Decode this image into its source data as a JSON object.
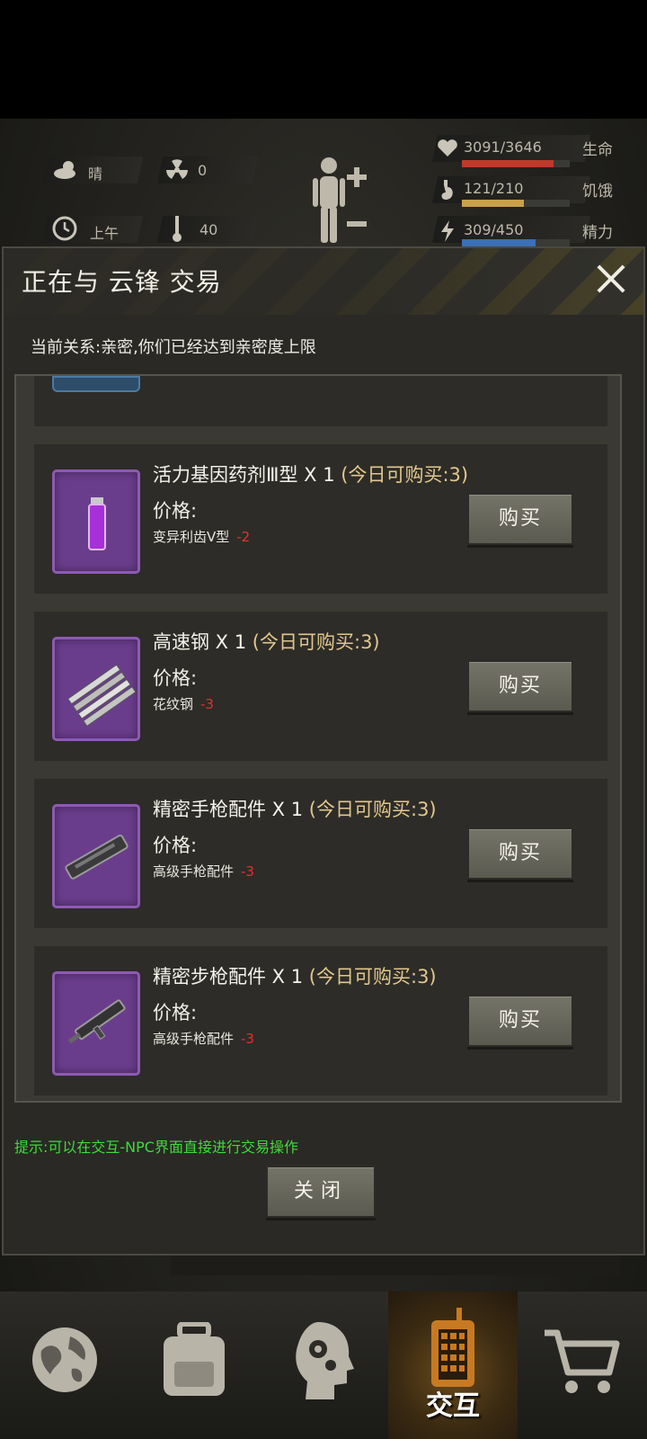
{
  "status": {
    "weather": "晴",
    "radiation": "0",
    "time_of_day": "上午",
    "temperature": "40",
    "health": {
      "value": "3091/3646",
      "label": "生命",
      "fraction": 0.848,
      "color": "#c0392b"
    },
    "hunger": {
      "value": "121/210",
      "label": "饥饿",
      "fraction": 0.576,
      "color": "#c8a14a"
    },
    "energy": {
      "value": "309/450",
      "label": "精力",
      "fraction": 0.687,
      "color": "#3c6fb5"
    }
  },
  "dialog": {
    "title": "正在与 云锋 交易",
    "relation": "当前关系:亲密,你们已经达到亲密度上限",
    "price_label": "价格:",
    "buy_label": "购买",
    "items": [
      {
        "name": "活力基因药剂Ⅲ型 X 1",
        "limit": "(今日可购买:3)",
        "price_item": "变异利齿Ⅴ型",
        "price_cost": "-2",
        "icon": "vial-icon"
      },
      {
        "name": "高速钢 X 1",
        "limit": "(今日可购买:3)",
        "price_item": "花纹钢",
        "price_cost": "-3",
        "icon": "steel-bars-icon"
      },
      {
        "name": "精密手枪配件 X 1",
        "limit": "(今日可购买:3)",
        "price_item": "高级手枪配件",
        "price_cost": "-3",
        "icon": "pistol-part-icon"
      },
      {
        "name": "精密步枪配件 X 1",
        "limit": "(今日可购买:3)",
        "price_item": "高级手枪配件",
        "price_cost": "-3",
        "icon": "rifle-part-icon"
      }
    ],
    "hint": "提示:可以在交互-NPC界面直接进行交易操作",
    "close_label": "关闭"
  },
  "bottom_nav": {
    "active_label": "交互",
    "items": [
      "globe-icon",
      "backpack-icon",
      "head-gear-icon",
      "radio-icon",
      "cart-icon"
    ]
  }
}
